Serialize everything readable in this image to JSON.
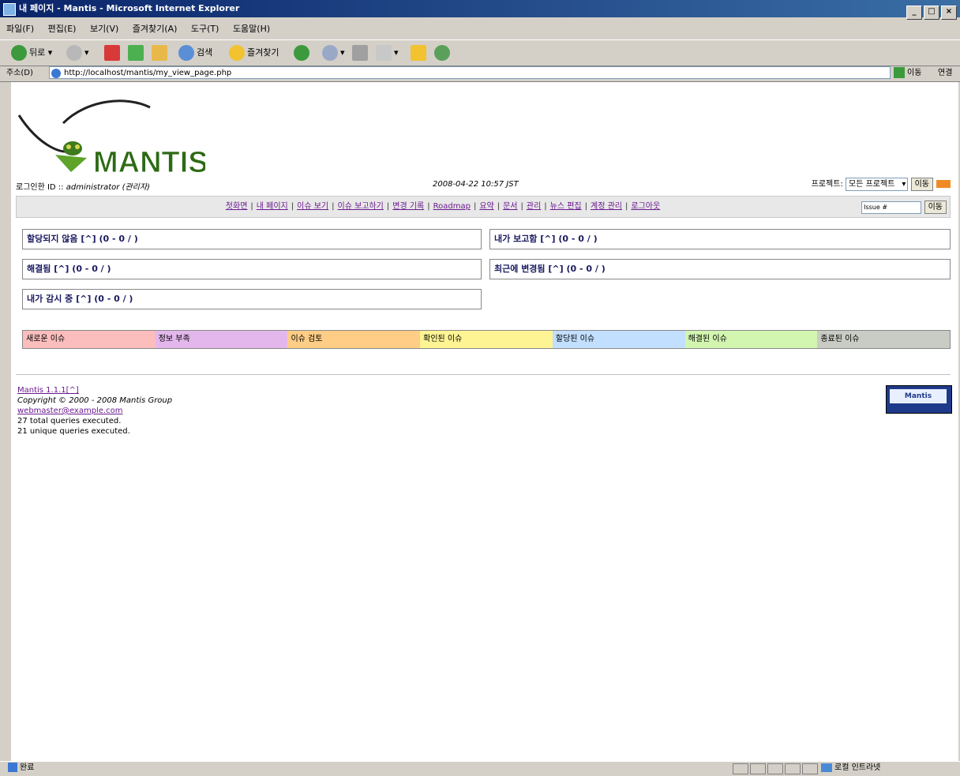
{
  "window": {
    "title": "내 페이지 - Mantis - Microsoft Internet Explorer"
  },
  "menu": [
    "파일(F)",
    "편집(E)",
    "보기(V)",
    "즐겨찾기(A)",
    "도구(T)",
    "도움말(H)"
  ],
  "toolbar": {
    "back": "뒤로",
    "search": "검색",
    "favorites": "즐겨찾기"
  },
  "address": {
    "label": "주소(D)",
    "url": "http://localhost/mantis/my_view_page.php",
    "go": "이동",
    "links": "연결"
  },
  "header": {
    "logo_text": "MANTIS",
    "login_label": "로그인한 ID :: ",
    "user": "administrator",
    "role": "(관리자)",
    "datetime": "2008-04-22 10:57 JST",
    "project_label": "프로젝트:",
    "project_value": "모든 프로젝트",
    "project_btn": "이동"
  },
  "nav": {
    "links": [
      "첫화면",
      "내 페이지",
      "이슈 보기",
      "이슈 보고하기",
      "변경 기록",
      "Roadmap",
      "요약",
      "문서",
      "관리",
      "뉴스 편집",
      "계정 관리",
      "로그아웃"
    ],
    "issue_placeholder": "Issue #",
    "jump_btn": "이동"
  },
  "boxes": {
    "unassigned": "할당되지 않음 [^] (0 - 0 / )",
    "reported": "내가 보고함 [^] (0 - 0 / )",
    "resolved": "해결됨 [^] (0 - 0 / )",
    "recent": "최근에 변경됨 [^] (0 - 0 / )",
    "monitored": "내가 감시 중 [^] (0 - 0 / )"
  },
  "legend": [
    {
      "label": "새로운 이슈",
      "color": "#fcbdbd"
    },
    {
      "label": "정보 부족",
      "color": "#e3b7eb"
    },
    {
      "label": "이슈 검토",
      "color": "#ffcd85"
    },
    {
      "label": "확인된 이슈",
      "color": "#fff494"
    },
    {
      "label": "할당된 이슈",
      "color": "#c2dfff"
    },
    {
      "label": "해결된 이슈",
      "color": "#d2f5b0"
    },
    {
      "label": "종료된 이슈",
      "color": "#c9ccc4"
    }
  ],
  "footer": {
    "version": "Mantis 1.1.1[^]",
    "copyright": "Copyright © 2000 - 2008 Mantis Group",
    "email": "webmaster@example.com",
    "queries_total": "27 total queries executed.",
    "queries_unique": "21 unique queries executed.",
    "badge": "Mantis"
  },
  "status": {
    "left": "완료",
    "zone": "로컬 인트라넷"
  }
}
